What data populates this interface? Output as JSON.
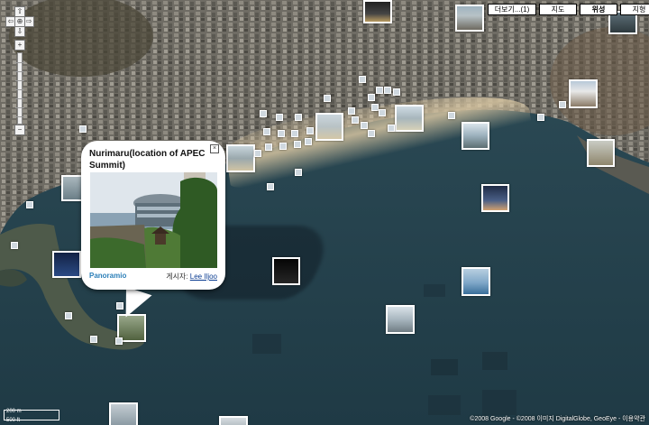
{
  "map_type_buttons": {
    "more": "더보기...(1)",
    "map": "지도",
    "satellite": "위성",
    "terrain": "지형"
  },
  "zoom": {
    "in_label": "+",
    "out_label": "−",
    "pan_up": "⇧",
    "pan_left": "⇦",
    "pan_right": "⇨",
    "pan_down": "⇩",
    "center": "⊕"
  },
  "popup": {
    "title": "Nurimaru(location of APEC Summit)",
    "logo": "Panoramio",
    "poster_label": "게시자:",
    "poster_name": "Lee Iljoo",
    "close_label": "×"
  },
  "scale": {
    "metric": "200 m",
    "imperial": "500 ft"
  },
  "copyright": "©2008 Google - ©2008 이미지 DigitalGlobe, GeoEye - 이용약관"
}
